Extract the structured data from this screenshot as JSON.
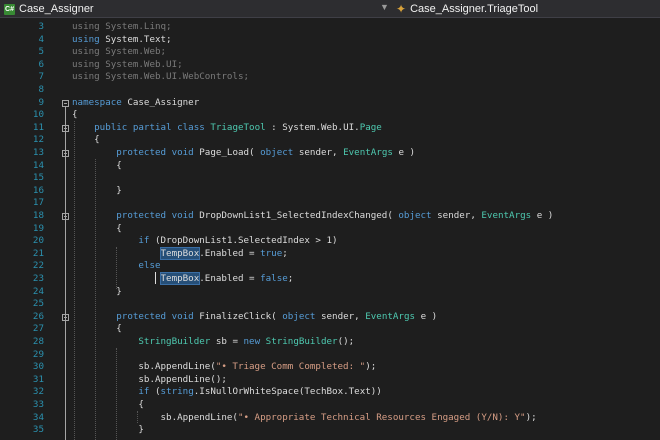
{
  "navbar": {
    "project": "Case_Assigner",
    "member": "Case_Assigner.TriageTool",
    "project_icon": "csharp-file-icon",
    "member_icon": "class-icon"
  },
  "lines": [
    {
      "n": "3",
      "parts": [
        [
          "dim",
          "using "
        ],
        [
          "dim",
          "System.Linq;"
        ]
      ]
    },
    {
      "n": "4",
      "parts": [
        [
          "kw",
          "using "
        ],
        [
          "",
          "System.Text;"
        ]
      ]
    },
    {
      "n": "5",
      "parts": [
        [
          "dim",
          "using "
        ],
        [
          "dim",
          "System.Web;"
        ]
      ]
    },
    {
      "n": "6",
      "parts": [
        [
          "dim",
          "using "
        ],
        [
          "dim",
          "System.Web.UI;"
        ]
      ]
    },
    {
      "n": "7",
      "parts": [
        [
          "dim",
          "using "
        ],
        [
          "dim",
          "System.Web.UI.WebControls;"
        ]
      ]
    },
    {
      "n": "8",
      "parts": []
    },
    {
      "n": "9",
      "parts": [
        [
          "kw",
          "namespace "
        ],
        [
          "",
          "Case_Assigner"
        ]
      ]
    },
    {
      "n": "10",
      "parts": [
        [
          "",
          "{"
        ]
      ]
    },
    {
      "n": "11",
      "parts": [
        [
          "",
          "    "
        ],
        [
          "kw",
          "public partial class "
        ],
        [
          "ty",
          "TriageTool"
        ],
        [
          "",
          " : System.Web.UI."
        ],
        [
          "ty",
          "Page"
        ]
      ]
    },
    {
      "n": "12",
      "parts": [
        [
          "",
          "    {"
        ]
      ]
    },
    {
      "n": "13",
      "parts": [
        [
          "",
          "        "
        ],
        [
          "kw",
          "protected void "
        ],
        [
          "",
          "Page_Load( "
        ],
        [
          "kw",
          "object "
        ],
        [
          "",
          "sender, "
        ],
        [
          "ty",
          "EventArgs"
        ],
        [
          "",
          " e )"
        ]
      ]
    },
    {
      "n": "14",
      "parts": [
        [
          "",
          "        {"
        ]
      ]
    },
    {
      "n": "15",
      "parts": []
    },
    {
      "n": "16",
      "parts": [
        [
          "",
          "        }"
        ]
      ]
    },
    {
      "n": "17",
      "parts": []
    },
    {
      "n": "18",
      "parts": [
        [
          "",
          "        "
        ],
        [
          "kw",
          "protected void "
        ],
        [
          "",
          "DropDownList1_SelectedIndexChanged( "
        ],
        [
          "kw",
          "object "
        ],
        [
          "",
          "sender, "
        ],
        [
          "ty",
          "EventArgs"
        ],
        [
          "",
          " e )"
        ]
      ]
    },
    {
      "n": "19",
      "parts": [
        [
          "",
          "        {"
        ]
      ]
    },
    {
      "n": "20",
      "parts": [
        [
          "",
          "            "
        ],
        [
          "kw",
          "if "
        ],
        [
          "",
          "(DropDownList1.SelectedIndex > 1)"
        ]
      ]
    },
    {
      "n": "21",
      "parts": [
        [
          "",
          "                "
        ],
        [
          "hl",
          "TempBox"
        ],
        [
          "",
          ".Enabled = "
        ],
        [
          "kw",
          "true"
        ],
        [
          "",
          ";"
        ]
      ]
    },
    {
      "n": "22",
      "parts": [
        [
          "",
          "            "
        ],
        [
          "kw",
          "else"
        ]
      ]
    },
    {
      "n": "23",
      "parts": [
        [
          "",
          "                "
        ],
        [
          "hl",
          "TempBox"
        ],
        [
          "",
          ".Enabled = "
        ],
        [
          "kw",
          "false"
        ],
        [
          "",
          ";"
        ]
      ]
    },
    {
      "n": "24",
      "parts": [
        [
          "",
          "        }"
        ]
      ]
    },
    {
      "n": "25",
      "parts": []
    },
    {
      "n": "26",
      "parts": [
        [
          "",
          "        "
        ],
        [
          "kw",
          "protected void "
        ],
        [
          "",
          "FinalizeClick( "
        ],
        [
          "kw",
          "object "
        ],
        [
          "",
          "sender, "
        ],
        [
          "ty",
          "EventArgs"
        ],
        [
          "",
          " e )"
        ]
      ]
    },
    {
      "n": "27",
      "parts": [
        [
          "",
          "        {"
        ]
      ]
    },
    {
      "n": "28",
      "parts": [
        [
          "",
          "            "
        ],
        [
          "ty",
          "StringBuilder"
        ],
        [
          "",
          " sb = "
        ],
        [
          "kw",
          "new "
        ],
        [
          "ty",
          "StringBuilder"
        ],
        [
          "",
          "();"
        ]
      ]
    },
    {
      "n": "29",
      "parts": []
    },
    {
      "n": "30",
      "parts": [
        [
          "",
          "            sb.AppendLine("
        ],
        [
          "str",
          "\"• Triage Comm Completed: \""
        ],
        [
          "",
          ");"
        ]
      ]
    },
    {
      "n": "31",
      "parts": [
        [
          "",
          "            sb.AppendLine();"
        ]
      ]
    },
    {
      "n": "32",
      "parts": [
        [
          "",
          "            "
        ],
        [
          "kw",
          "if "
        ],
        [
          "",
          "("
        ],
        [
          "kw",
          "string"
        ],
        [
          "",
          ".IsNullOrWhiteSpace(TechBox.Text))"
        ]
      ]
    },
    {
      "n": "33",
      "parts": [
        [
          "",
          "            {"
        ]
      ]
    },
    {
      "n": "34",
      "parts": [
        [
          "",
          "                sb.AppendLine("
        ],
        [
          "str",
          "\"• Appropriate Technical Resources Engaged (Y/N): Y\""
        ],
        [
          "",
          ");"
        ]
      ]
    },
    {
      "n": "35",
      "parts": [
        [
          "",
          "            }"
        ]
      ]
    }
  ]
}
